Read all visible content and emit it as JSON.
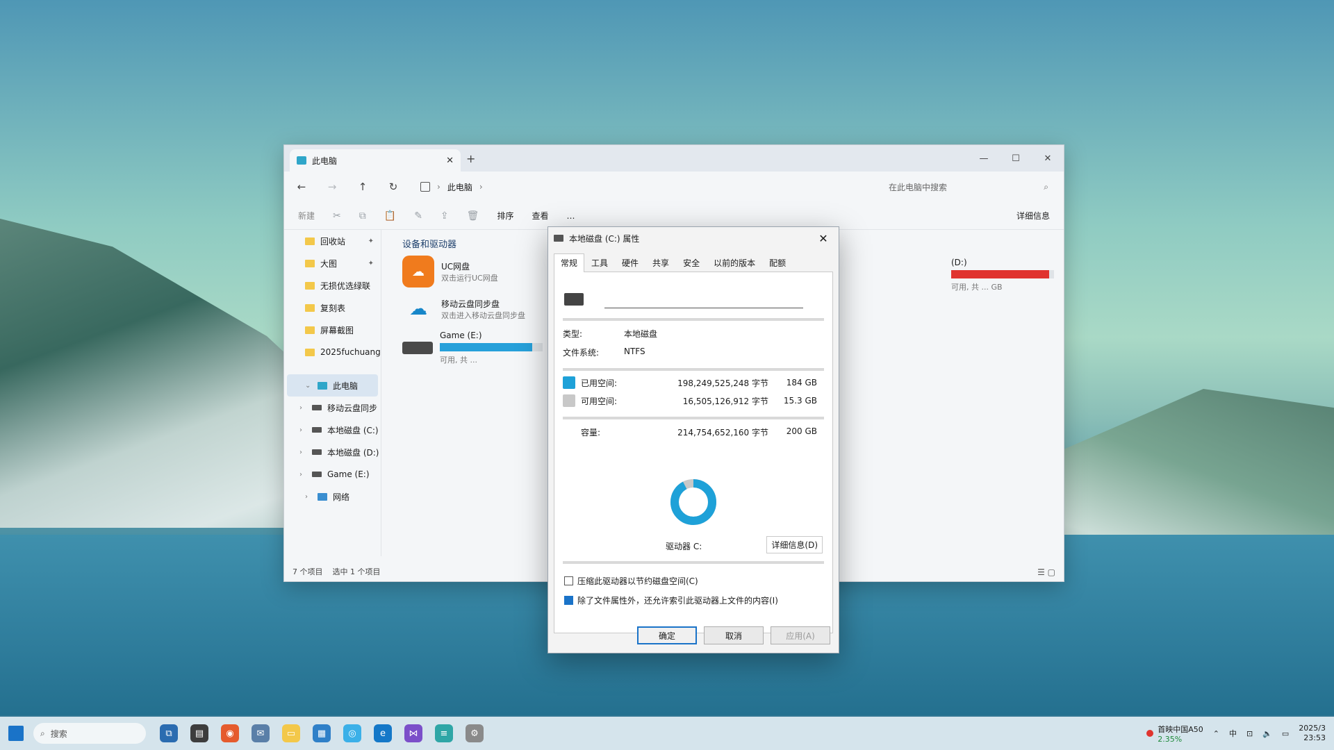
{
  "explorer": {
    "tab_title": "此电脑",
    "tab_new": "+",
    "address": "此电脑",
    "search_placeholder": "在此电脑中搜索",
    "cmd": {
      "new": "新建",
      "sort": "排序",
      "view": "查看",
      "more": "…",
      "details": "详细信息"
    },
    "sidebar": {
      "quick": [
        {
          "label": "回收站"
        },
        {
          "label": "大图"
        },
        {
          "label": "无损优选绿联"
        },
        {
          "label": "复刻表"
        },
        {
          "label": "屏幕截图"
        },
        {
          "label": "2025fuchuang"
        }
      ],
      "this_pc": "此电脑",
      "drives": [
        {
          "label": "移动云盘同步"
        },
        {
          "label": "本地磁盘 (C:)"
        },
        {
          "label": "本地磁盘 (D:)"
        },
        {
          "label": "Game (E:)"
        }
      ],
      "network": "网络"
    },
    "section": "设备和驱动器",
    "devices": [
      {
        "name": "UC网盘",
        "sub": "双击运行UC网盘"
      },
      {
        "name": "移动云盘同步盘",
        "sub": "双击进入移动云盘同步盘"
      },
      {
        "name": "Game (E:)",
        "sub": "可用, 共 ..."
      }
    ],
    "right_label": "(D:)",
    "right_sub": "可用, 共 ... GB",
    "status_items": "7 个项目",
    "status_selected": "选中 1 个项目"
  },
  "dialog": {
    "title": "本地磁盘 (C:) 属性",
    "tabs": [
      "常规",
      "工具",
      "硬件",
      "共享",
      "安全",
      "以前的版本",
      "配额"
    ],
    "name_value": "",
    "type_label": "类型:",
    "type_value": "本地磁盘",
    "fs_label": "文件系统:",
    "fs_value": "NTFS",
    "used_label": "已用空间:",
    "used_bytes": "198,249,525,248 字节",
    "used_gb": "184 GB",
    "free_label": "可用空间:",
    "free_bytes": "16,505,126,912 字节",
    "free_gb": "15.3 GB",
    "total_label": "容量:",
    "total_bytes": "214,754,652,160 字节",
    "total_gb": "200 GB",
    "used_fraction": 0.923,
    "drive_label": "驱动器 C:",
    "details_button": "详细信息(D)",
    "compress_label": "压缩此驱动器以节约磁盘空间(C)",
    "index_label": "除了文件属性外，还允许索引此驱动器上文件的内容(I)",
    "ok": "确定",
    "cancel": "取消",
    "apply": "应用(A)"
  },
  "taskbar": {
    "search": "搜索",
    "weather_title": "首映中国A50",
    "weather_sub": "2.35%",
    "clock_time": "2025/3",
    "clock_date": "23:53"
  },
  "colors": {
    "accent": "#1a73c8",
    "used": "#1ea1d8",
    "free": "#c8c8c8",
    "low_space": "#e0342f"
  }
}
